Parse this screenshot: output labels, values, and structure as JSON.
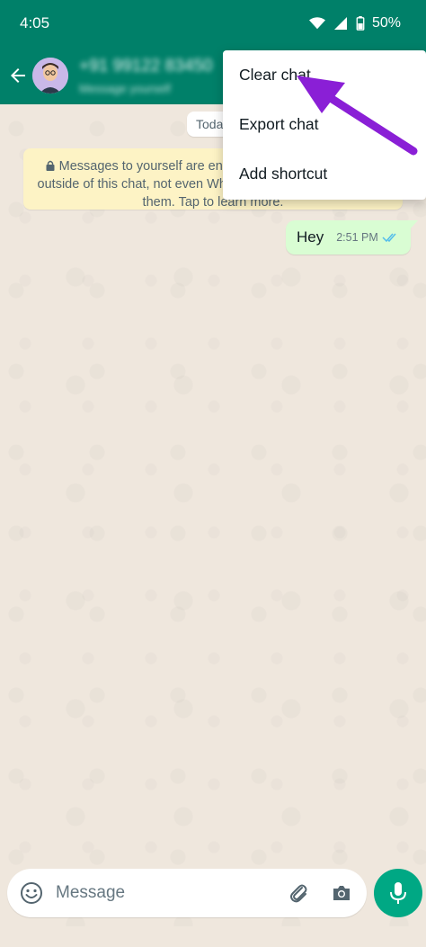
{
  "status_bar": {
    "time": "4:05",
    "battery": "50%"
  },
  "header": {
    "contact_name": "+91 99122 83450",
    "contact_status": "Message yourself"
  },
  "chat": {
    "date_chip": "Today",
    "system_note": "Messages to yourself are end-to-end encrypted. No one outside of this chat, not even WhatsApp, can read or listen to them. Tap to learn more.",
    "messages": [
      {
        "text": "Hey",
        "time": "2:51 PM",
        "status": "read"
      }
    ]
  },
  "menu": {
    "items": [
      {
        "label": "Clear chat"
      },
      {
        "label": "Export chat"
      },
      {
        "label": "Add shortcut"
      }
    ]
  },
  "composer": {
    "placeholder": "Message"
  },
  "colors": {
    "header": "#008069",
    "accent": "#00a884",
    "outgoing_bubble": "#d9fdd3",
    "wallpaper": "#efe7dd",
    "annotation_arrow": "#8a1fd6",
    "read_ticks": "#53bdeb"
  }
}
